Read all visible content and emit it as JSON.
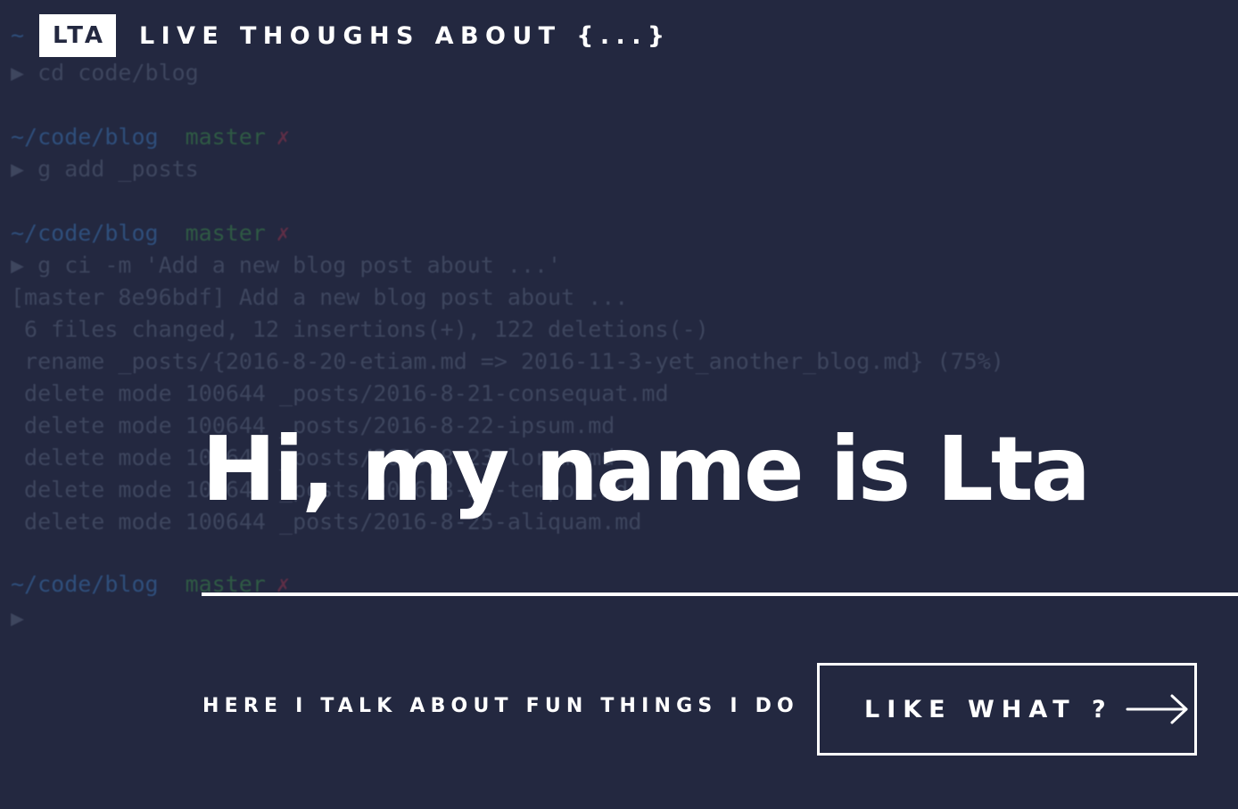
{
  "header": {
    "logo_text": "LTA",
    "site_title": "LIVE THOUGHS ABOUT {...}"
  },
  "hero": {
    "title": "Hi, my name is Lta",
    "tagline": "HERE I TALK ABOUT FUN THINGS I DO",
    "cta_label": "LIKE WHAT ?",
    "cta_icon": "arrow-right-icon"
  },
  "terminal": {
    "lines": [
      "~",
      "▶ cd code/blog",
      "~/code/blog  master ✗",
      "▶ g add _posts",
      "~/code/blog  master ✗",
      "▶ g ci -m 'Add a new blog post about ...'",
      "[master 8e96bdf] Add a new blog post about ...",
      " 6 files changed, 12 insertions(+), 122 deletions(-)",
      " rename _posts/{2016-8-20-etiam.md => 2016-11-3-yet_another_blog.md} (75%)",
      " delete mode 100644 _posts/2016-8-21-consequat.md",
      " delete mode 100644 _posts/2016-8-22-ipsum.md",
      " delete mode 100644 _posts/2016-8-23-lorem.md",
      " delete mode 100644 _posts/2016-8-24-tempor.md",
      " delete mode 100644 _posts/2016-8-25-aliquam.md",
      "~/code/blog  master ✗",
      "▶"
    ]
  },
  "colors": {
    "background": "#232840",
    "foreground": "#ffffff",
    "terminal_text": "#3e465e",
    "terminal_path": "#2f4f7c",
    "terminal_branch": "#2f5a44",
    "terminal_dirty": "#5e2e46"
  }
}
